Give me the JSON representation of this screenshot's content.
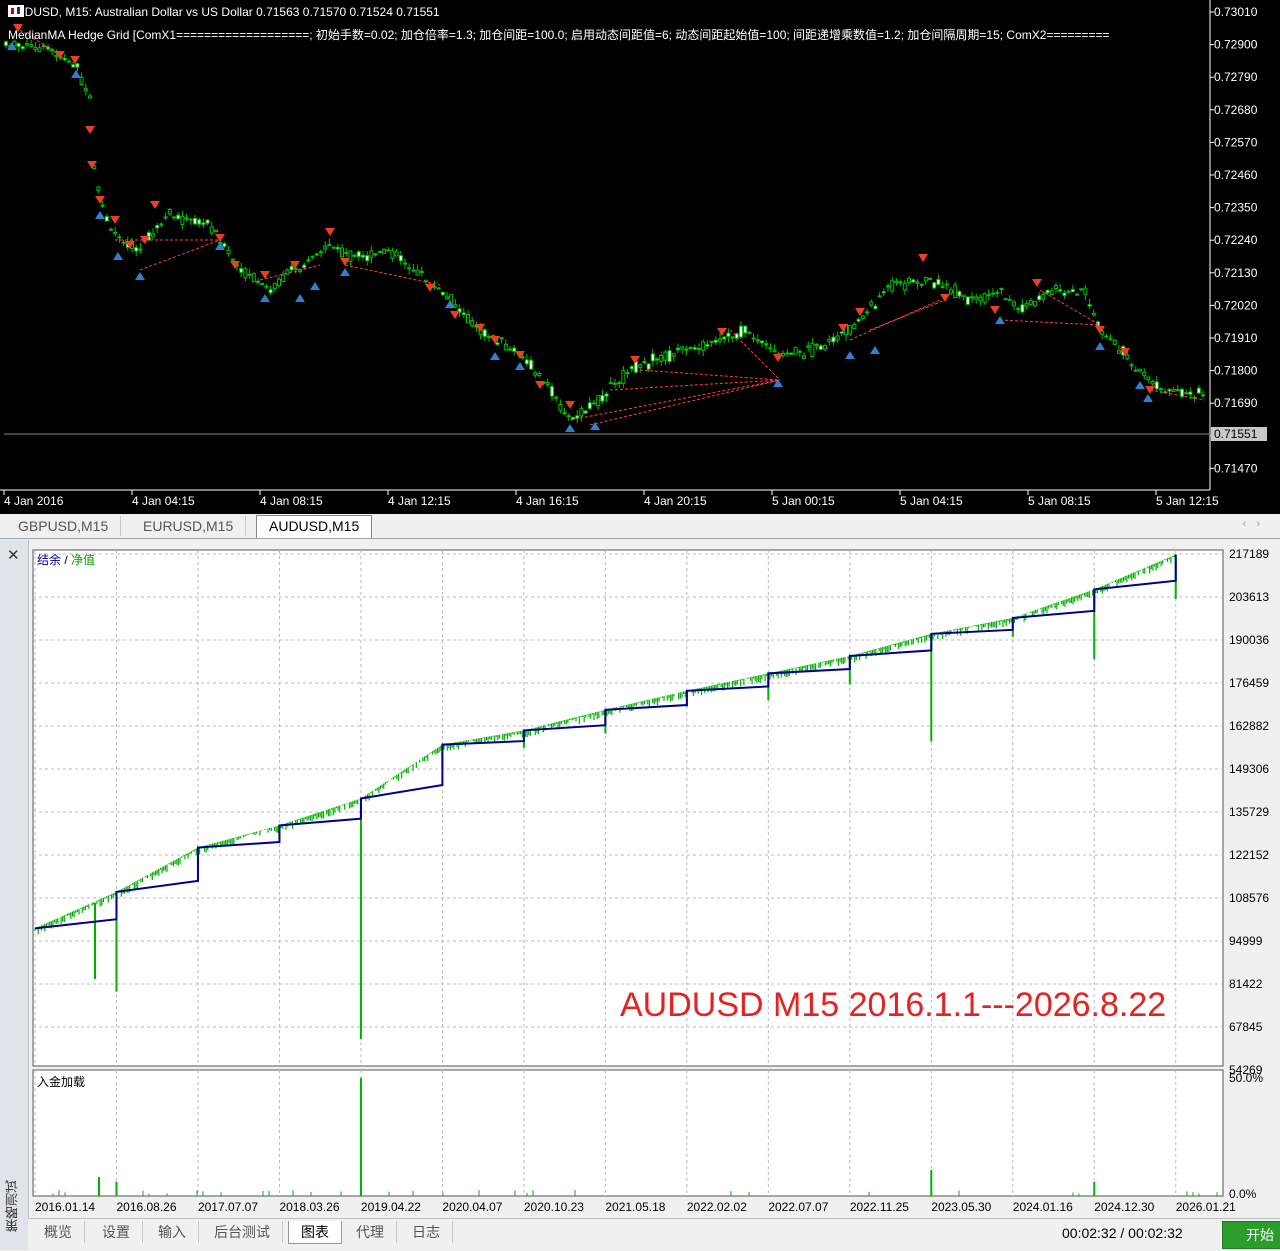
{
  "price_chart": {
    "header": "AUDUSD, M15:  Australian Dollar vs US Dollar  0.71563 0.71570 0.71524 0.71551",
    "ea_params": "MedianMA Hedge Grid [ComX1===================; 初始手数=0.02; 加仓倍率=1.3; 加仓间距=100.0; 启用动态间距值=6; 动态间距起始值=100; 间距递增乘数值=1.2; 加仓间隔周期=15; ComX2=========",
    "price_labels": [
      "0.73010",
      "0.72900",
      "0.72790",
      "0.72680",
      "0.72570",
      "0.72460",
      "0.72350",
      "0.72240",
      "0.72130",
      "0.72020",
      "0.71910",
      "0.71800",
      "0.71690",
      "0.71580",
      "0.71470"
    ],
    "current_price": "0.71551",
    "time_labels": [
      "4 Jan 2016",
      "4 Jan 04:15",
      "4 Jan 08:15",
      "4 Jan 12:15",
      "4 Jan 16:15",
      "4 Jan 20:15",
      "5 Jan 00:15",
      "5 Jan 04:15",
      "5 Jan 08:15",
      "5 Jan 12:15"
    ],
    "colors": {
      "bull": "#00c000",
      "bear": "#00c000",
      "sell_arrow": "#e84020",
      "buy_arrow": "#2f7fd0",
      "grid_line": "#ff4040"
    }
  },
  "chart_tabs": [
    "GBPUSD,M15",
    "EURUSD,M15",
    "AUDUSD,M15"
  ],
  "active_chart_tab": "AUDUSD,M15",
  "tester": {
    "side_label": "策略测试",
    "legend_balance": "结余",
    "legend_sep": "/",
    "legend_equity": "净值",
    "overlay_title": "AUDUSD M15 2016.1.1---2026.8.22",
    "deposit_label": "入金加载",
    "deposit_axis": [
      "50.0%",
      "0.0%"
    ],
    "colors": {
      "balance": "#00008b",
      "equity": "#00b000",
      "deposit": "#00b000"
    }
  },
  "chart_data": {
    "type": "line",
    "x": [
      "2016.01.14",
      "2016.08.26",
      "2017.07.07",
      "2018.03.26",
      "2019.04.22",
      "2020.04.07",
      "2020.10.23",
      "2021.05.18",
      "2022.02.02",
      "2022.07.07",
      "2022.11.25",
      "2023.05.30",
      "2024.01.16",
      "2024.12.30",
      "2026.01.21"
    ],
    "y_ticks": [
      217189,
      203613,
      190036,
      176459,
      162882,
      149306,
      135729,
      122152,
      108576,
      94999,
      81422,
      67845,
      54269
    ],
    "ylim": [
      54269,
      217189
    ],
    "series": [
      {
        "values": [
          99000,
          110500,
          124500,
          131500,
          140000,
          157000,
          161500,
          168000,
          174000,
          179500,
          185000,
          192000,
          197000,
          206000,
          217000
        ]
      },
      {
        "values": [
          83000,
          79000,
          121000,
          128000,
          64000,
          150000,
          156000,
          160500,
          169000,
          171000,
          176000,
          158000,
          191000,
          184000,
          203000
        ]
      }
    ],
    "deposit_spikes": [
      {
        "x": "2016.01.14",
        "pct": 0.08
      },
      {
        "x": "2016.08.26",
        "pct": 0.06
      },
      {
        "x": "2019.04.22",
        "pct": 0.5
      },
      {
        "x": "2023.05.30",
        "pct": 0.11
      },
      {
        "x": "2024.12.30",
        "pct": 0.06
      }
    ]
  },
  "bottom_tabs": [
    "概览",
    "设置",
    "输入",
    "后台测试",
    "图表",
    "代理",
    "日志"
  ],
  "active_bottom_tab": "图表",
  "timer": "00:02:32 / 00:02:32",
  "start_button": "开始"
}
